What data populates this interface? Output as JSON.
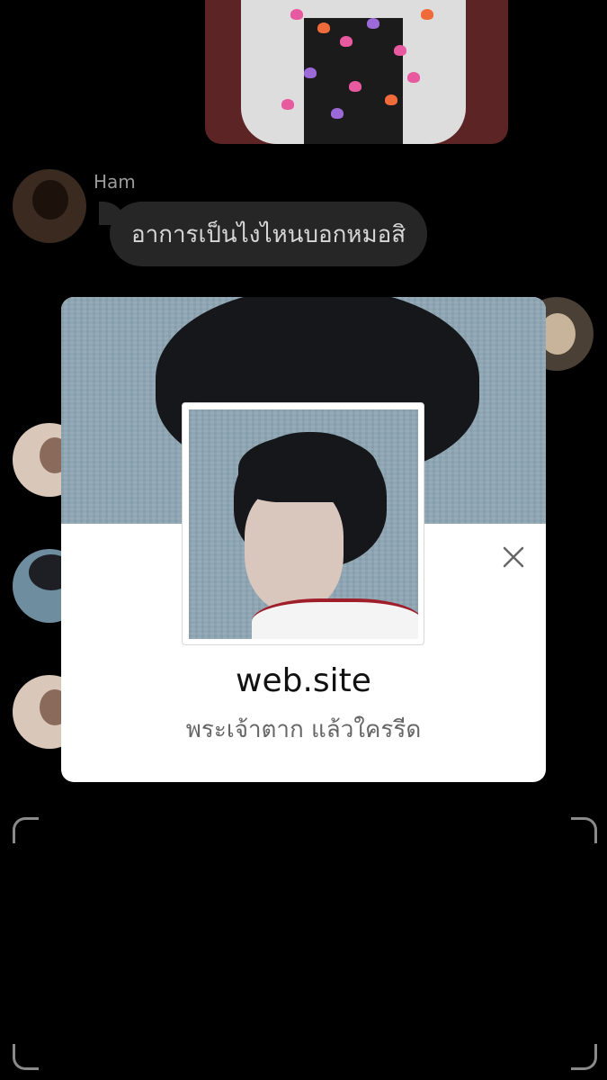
{
  "chat": {
    "sender_name": "Ham",
    "message": "อาการเป็นไงไหนบอกหมอสิ"
  },
  "profile_card": {
    "title": "web.site",
    "description": "พระเจ้าตาก แล้วใครรีด",
    "close_icon": "close-icon"
  },
  "colors": {
    "background": "#000000",
    "bubble": "#262626",
    "card": "#ffffff"
  }
}
